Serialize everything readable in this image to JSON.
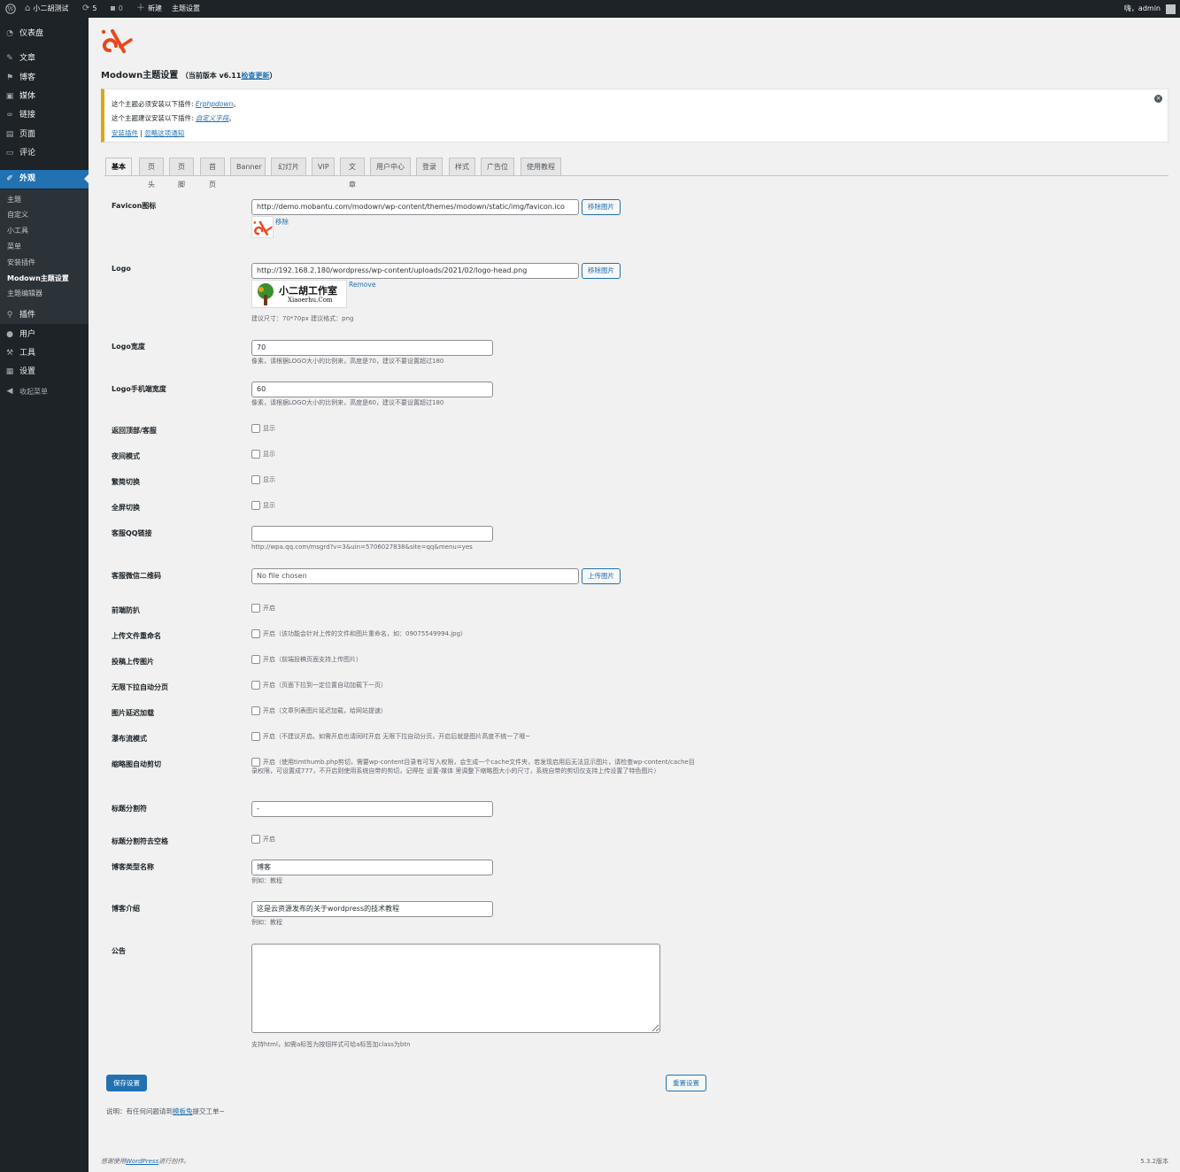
{
  "adminbar": {
    "site_name": "小二胡测试",
    "updates": "5",
    "comments": "0",
    "new_label": "新建",
    "theme_settings": "主题设置",
    "howdy": "嗨，admin"
  },
  "menu": {
    "dashboard": "仪表盘",
    "posts": "文章",
    "blog": "博客",
    "media": "媒体",
    "links": "链接",
    "pages": "页面",
    "comments": "评论",
    "appearance": "外观",
    "plugins": "插件",
    "users": "用户",
    "tools": "工具",
    "settings": "设置",
    "collapse": "收起菜单"
  },
  "submenu": {
    "themes": "主题",
    "customize": "自定义",
    "widgets": "小工具",
    "menus": "菜单",
    "install_plugins": "安装插件",
    "modown_settings": "Modown主题设置",
    "theme_editor": "主题编辑器"
  },
  "page": {
    "title": "Modown主题设置",
    "version": "（当前版本 v6.11",
    "check_update": "检查更新",
    "version_close": "）"
  },
  "notice": {
    "line1_prefix": "这个主题必须安装以下插件: ",
    "line1_plugin": "Erphpdown",
    "line1_suffix": "。",
    "line2_prefix": "这个主题建议安装以下插件: ",
    "line2_plugin": "自定义字段",
    "line2_suffix": "。",
    "install_link": "安装插件",
    "sep": " | ",
    "dismiss_link": "忽略这项通知"
  },
  "tabs": [
    "基本",
    "页头",
    "页脚",
    "首页",
    "Banner",
    "幻灯片",
    "VIP",
    "文章",
    "用户中心",
    "登录",
    "样式",
    "广告位",
    "使用教程"
  ],
  "form": {
    "favicon": {
      "label": "Favicon图标",
      "value": "http://demo.mobantu.com/modown/wp-content/themes/modown/static/img/favicon.ico",
      "button": "移除图片",
      "remove": "移除"
    },
    "logo": {
      "label": "Logo",
      "value": "http://192.168.2.180/wordpress/wp-content/uploads/2021/02/logo-head.png",
      "button": "移除图片",
      "remove": "Remove",
      "desc": "建议尺寸：70*70px 建议格式：png",
      "thumb_text": "小二胡工作室",
      "thumb_sub": "Xiaoerhu.Com"
    },
    "logo_width": {
      "label": "Logo宽度",
      "value": "70",
      "desc": "像素，请根据LOGO大小的比例来，高度是70，建议不要设置超过180"
    },
    "logo_mobile_width": {
      "label": "Logo手机端宽度",
      "value": "60",
      "desc": "像素，请根据LOGO大小的比例来，高度是60，建议不要设置超过180"
    },
    "back_top": {
      "label": "返回顶部/客服",
      "option": "显示"
    },
    "night_mode": {
      "label": "夜间模式",
      "option": "显示"
    },
    "trad_simp": {
      "label": "繁简切换",
      "option": "显示"
    },
    "fullscreen": {
      "label": "全屏切换",
      "option": "显示"
    },
    "qq_link": {
      "label": "客服QQ链接",
      "value": "",
      "desc": "http://wpa.qq.com/msgrd?v=3&uin=5706027838&site=qq&menu=yes"
    },
    "wechat_qr": {
      "label": "客服微信二维码",
      "value": "No file chosen",
      "button": "上传图片"
    },
    "anti_scrape": {
      "label": "前端防扒",
      "option": "开启"
    },
    "rename_upload": {
      "label": "上传文件重命名",
      "option": "开启（该功能会针对上传的文件和图片重命名，如：09075549994.jpg）"
    },
    "post_upload_img": {
      "label": "投稿上传图片",
      "option": "开启（前端投稿页面支持上传图片）"
    },
    "infinite_scroll": {
      "label": "无限下拉自动分页",
      "option": "开启（页面下拉到一定位置自动加载下一页）"
    },
    "lazy_load": {
      "label": "图片延迟加载",
      "option": "开启（文章列表图片延迟加载，给网站提速）"
    },
    "waterfall": {
      "label": "瀑布流模式",
      "option": "开启（不建议开启。如需开启也请同时开启 无限下拉自动分页，开启后就是图片高度不统一了哦~"
    },
    "thumb_crop": {
      "label": "缩略图自动剪切",
      "option": "开启（使用timthumb.php剪切，需要wp-content目录有可写入权限，会生成一个cache文件夹，若发现启用后无法显示图片，请检查wp-content/cache目录权限，可设置成777，不开启则使用系统自带的剪切，记得在 设置-媒体 里调整下缩略图大小的尺寸，系统自带的剪切仅支持上传设置了特色图片）"
    },
    "title_sep": {
      "label": "标题分割符",
      "value": "-"
    },
    "title_sep_space": {
      "label": "标题分割符去空格",
      "option": "开启"
    },
    "blog_type_name": {
      "label": "博客类型名称",
      "value": "博客",
      "desc": "例如：教程"
    },
    "blog_intro": {
      "label": "博客介绍",
      "value": "这是云资源发布的关于wordpress的技术教程",
      "desc": "例如：教程"
    },
    "announcement": {
      "label": "公告",
      "desc": "支持html，如需a标签为按钮样式可给a标签加class为btn"
    }
  },
  "actions": {
    "save": "保存设置",
    "reset": "重置设置"
  },
  "note": {
    "prefix": "说明：有任何问题请到",
    "link": "模板兔",
    "suffix": "提交工单~"
  },
  "footer": {
    "prefix": "感谢使用",
    "link": "WordPress",
    "suffix": "进行创作。",
    "version": "5.3.2版本"
  },
  "colors": {
    "accent": "#2271b1",
    "brand": "#e8481e",
    "sidebar": "#1d2327"
  }
}
